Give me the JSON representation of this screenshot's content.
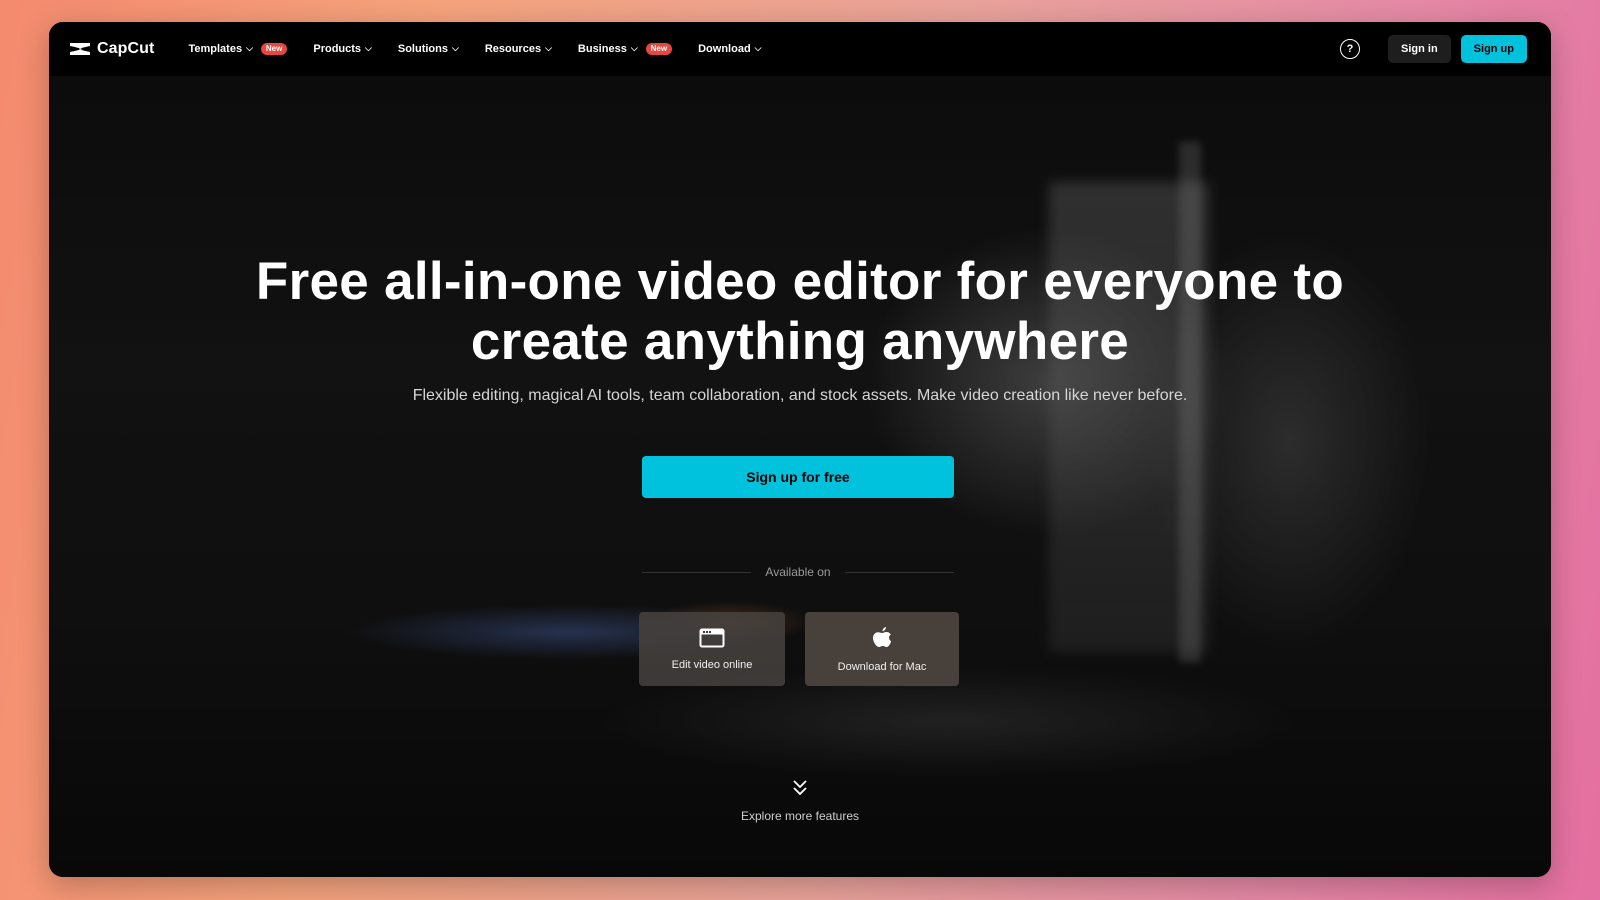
{
  "brand": {
    "name": "CapCut"
  },
  "nav": {
    "items": [
      {
        "label": "Templates",
        "badge": "New"
      },
      {
        "label": "Products",
        "badge": ""
      },
      {
        "label": "Solutions",
        "badge": ""
      },
      {
        "label": "Resources",
        "badge": ""
      },
      {
        "label": "Business",
        "badge": "New"
      },
      {
        "label": "Download",
        "badge": ""
      }
    ],
    "signin_label": "Sign in",
    "signup_label": "Sign up"
  },
  "hero": {
    "headline_line1": "Free all-in-one video editor for everyone to",
    "headline_line2": "create anything anywhere",
    "subheadline": "Flexible editing, magical AI tools, team collaboration, and stock assets. Make video creation like never before.",
    "cta_label": "Sign up for free",
    "available_label": "Available on",
    "platforms": [
      {
        "label": "Edit video online",
        "icon": "browser-window-icon"
      },
      {
        "label": "Download for Mac",
        "icon": "apple-icon"
      }
    ],
    "explore_label": "Explore more features"
  },
  "colors": {
    "accent": "#00c2dc",
    "badge": "#e8473f",
    "nav_bg": "#000000"
  }
}
